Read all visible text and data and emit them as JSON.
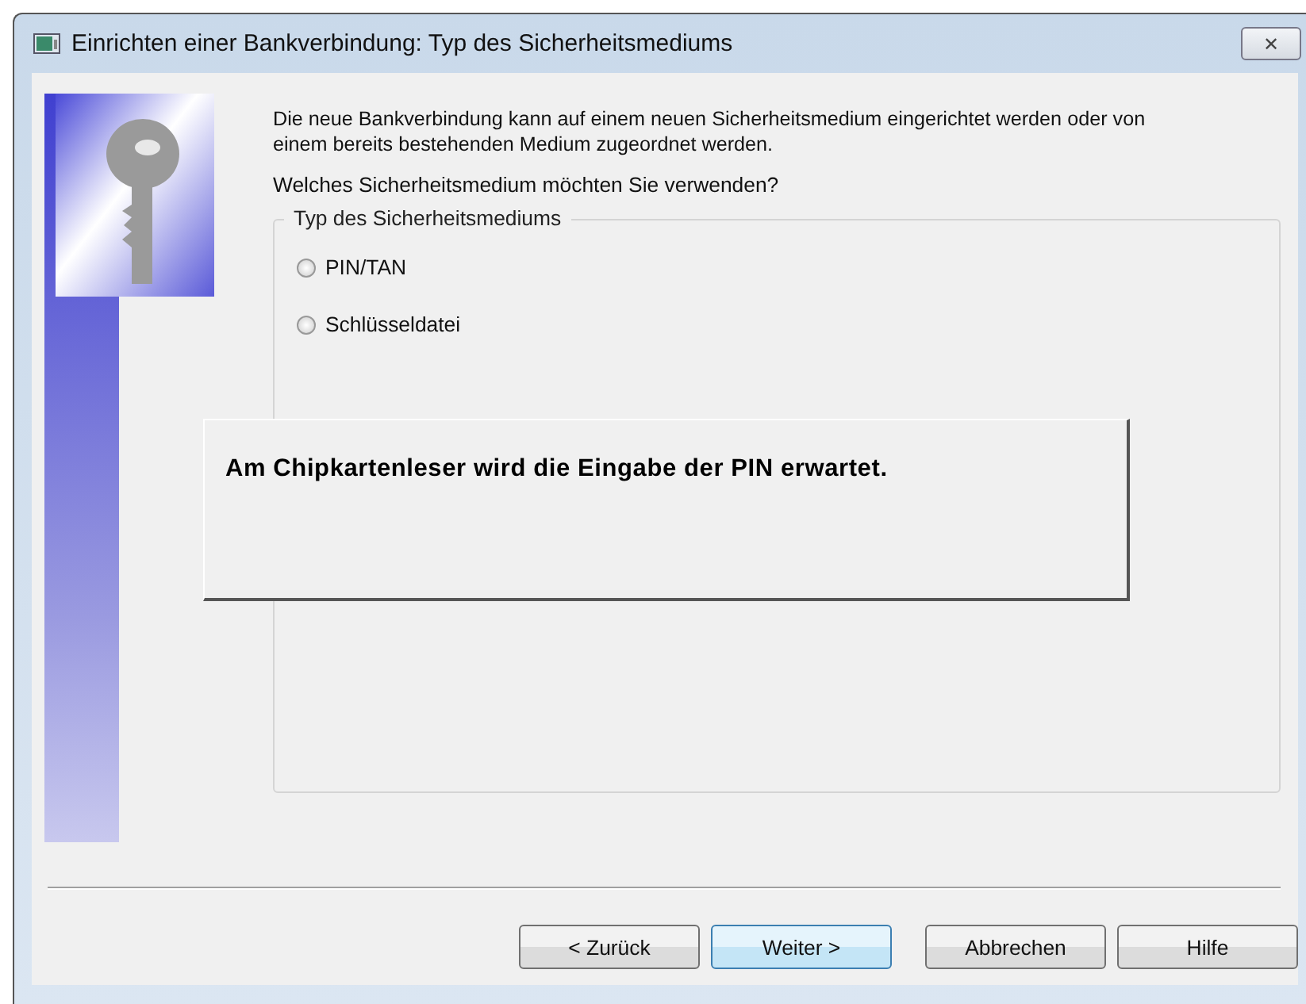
{
  "window": {
    "title": "Einrichten einer Bankverbindung: Typ des Sicherheitsmediums",
    "close_symbol": "✕"
  },
  "intro": "Die neue Bankverbindung kann  auf einem neuen Sicherheitsmedium eingerichtet werden oder von einem bereits bestehenden Medium zugeordnet werden.",
  "question": "Welches Sicherheitsmedium möchten Sie verwenden?",
  "group": {
    "title": "Typ des Sicherheitsmediums",
    "options": [
      {
        "label": "PIN/TAN",
        "selected": false
      },
      {
        "label": "Schlüsseldatei",
        "selected": false
      }
    ]
  },
  "message": "Am Chipkartenleser wird die Eingabe der PIN erwartet.",
  "buttons": [
    {
      "label": "< Zurück",
      "default": false
    },
    {
      "label": "Weiter >",
      "default": true
    },
    {
      "label": "Abbrechen",
      "default": false
    },
    {
      "label": "Hilfe",
      "default": false
    }
  ]
}
